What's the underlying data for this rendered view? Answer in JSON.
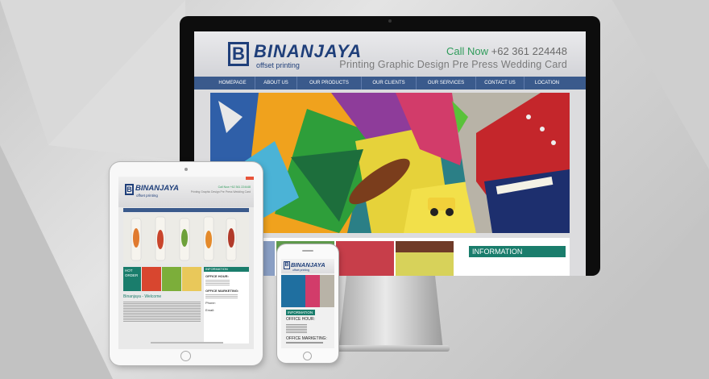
{
  "site": {
    "logo_letter": "B",
    "logo_name": "BINANJAYA",
    "logo_sub": "offset printing",
    "call_label": "Call Now",
    "phone": "+62 361 224448",
    "tagline": "Printing Graphic Design Pre Press Wedding Card",
    "nav": [
      "HOMEPAGE",
      "ABOUT US",
      "OUR PRODUCTS",
      "OUR CLIENTS",
      "OUR SERVICES",
      "CONTACT US",
      "LOCATION"
    ],
    "info_title": "INFORMATION"
  },
  "ipad": {
    "logo_name": "BINANJAYA",
    "logo_sub": "offset printing",
    "call_line": "Call Now +62 361 224448",
    "tagline": "Printing Graphic Design Pre Press Wedding Card",
    "hot_order": "HOT ORDER",
    "welcome": "Binanjaya - Welcome",
    "info_title": "INFORMATION",
    "office_hour": "OFFICE HOUR:",
    "office_marketing": "OFFICE MARKETING:",
    "phone_label": "Phone:",
    "email_label": "Email:"
  },
  "iphone": {
    "logo_name": "BINANJAYA",
    "logo_sub": "offset printing",
    "info_title": "INFORMATION",
    "office_hour": "OFFICE HOUR:",
    "office_marketing": "OFFICE MARKETING:"
  },
  "colors": {
    "brand_blue": "#1f3f7a",
    "nav_blue": "#3a5a8c",
    "accent_green": "#2e9b5a",
    "info_teal": "#1a7d6c"
  }
}
